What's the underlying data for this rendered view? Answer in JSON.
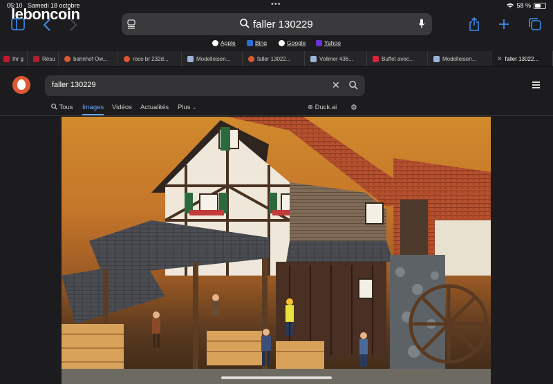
{
  "status": {
    "time": "05:10",
    "date": "Samedi 18 octobre",
    "battery": "58 %",
    "battery_level": 0.58
  },
  "overlay_logo": "leboncoin",
  "browser": {
    "address_query": "faller 130229",
    "favorites": [
      {
        "label": "Apple",
        "icon": "apple-icon"
      },
      {
        "label": "Bing",
        "icon": "bing-icon"
      },
      {
        "label": "Google",
        "icon": "google-icon"
      },
      {
        "label": "Yahoo",
        "icon": "yahoo-icon"
      }
    ],
    "tabs": [
      "Ihr g",
      "Résu",
      "bahnhof Ow...",
      "roco br 232d...",
      "Modelleisen...",
      "faller 13022...",
      "Vollmer 436...",
      "Buffet avec...",
      "Modelleisen...",
      "faller 13022..."
    ]
  },
  "ddg": {
    "query": "faller 130229",
    "nav": [
      "Tous",
      "Images",
      "Vidéos",
      "Actualités",
      "Plus"
    ],
    "duck_ai": "Duck.ai"
  },
  "colors": {
    "accent": "#3b8ef0",
    "link_active": "#6aa3ff",
    "ddg_orange": "#de5833"
  }
}
